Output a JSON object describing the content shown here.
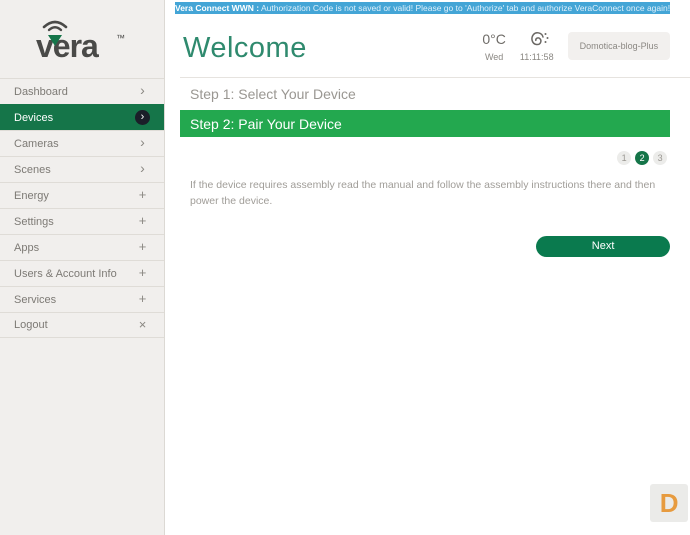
{
  "banner": {
    "prefix": "Vera Connect WWN :",
    "message": " Authorization Code is not saved or valid! Please go to 'Authorize' tab and authorize VeraConnect once again!"
  },
  "logo": {
    "text": "vera",
    "trademark": "™"
  },
  "sidebar": {
    "items": [
      {
        "label": "Dashboard",
        "glyph": "›"
      },
      {
        "label": "Devices",
        "glyph": "›"
      },
      {
        "label": "Cameras",
        "glyph": "›"
      },
      {
        "label": "Scenes",
        "glyph": "›"
      },
      {
        "label": "Energy",
        "glyph": "+"
      },
      {
        "label": "Settings",
        "glyph": "+"
      },
      {
        "label": "Apps",
        "glyph": "+"
      },
      {
        "label": "Users & Account Info",
        "glyph": "+"
      },
      {
        "label": "Services",
        "glyph": "+"
      },
      {
        "label": "Logout",
        "glyph": "×"
      }
    ]
  },
  "header": {
    "title": "Welcome",
    "weather": {
      "temperature": "0°C",
      "day": "Wed"
    },
    "clock": {
      "time": "11:11:58"
    },
    "device_selector": "Domotica-blog-Plus"
  },
  "wizard": {
    "step1_label": "Step 1: Select Your Device",
    "step2_label": "Step 2: Pair Your Device",
    "pagination": [
      "1",
      "2",
      "3"
    ],
    "active_page": "2",
    "instructions": "If the device requires assembly read the manual and follow the assembly instructions there and then power the device.",
    "next_label": "Next"
  },
  "badge": {
    "letter": "D"
  },
  "colors": {
    "banner_blue": "#44a5d6",
    "sidebar_selected_green": "#157549",
    "step_active_green": "#23a84f",
    "next_button_green": "#0a7a4e",
    "title_teal": "#2f8a6e",
    "badge_orange": "#e79b3f"
  }
}
